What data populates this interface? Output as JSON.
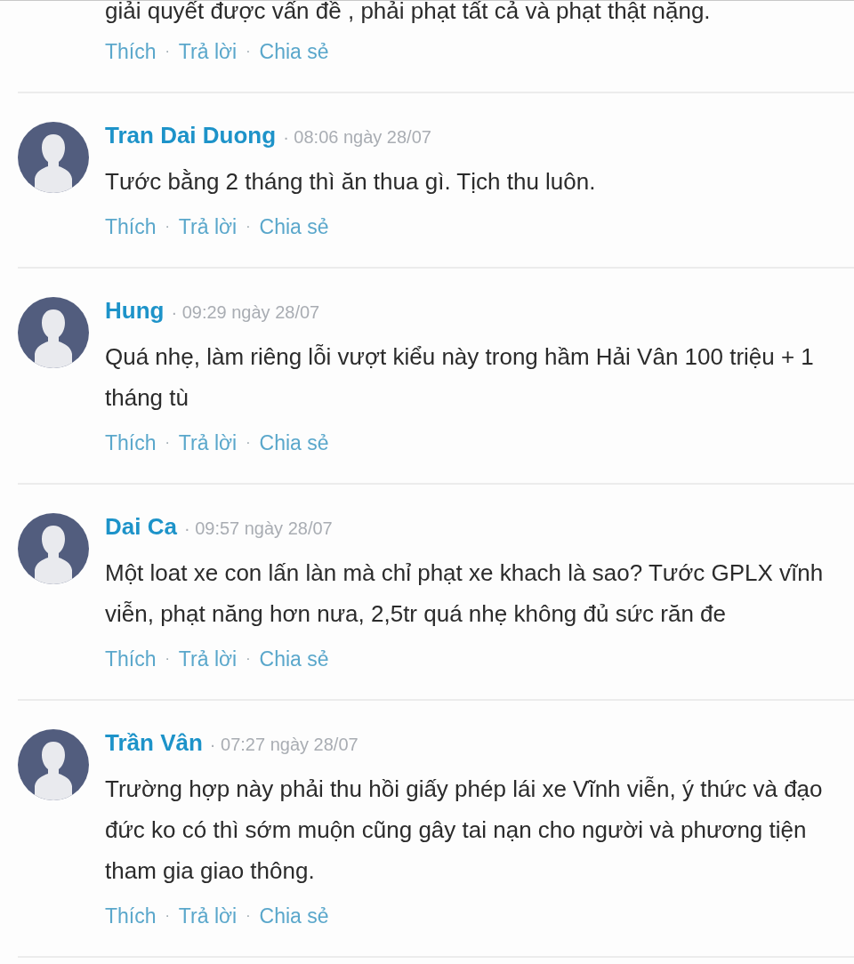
{
  "partial_comment": {
    "body": "giải quyết được vấn đề , phải phạt tất cả và phạt thật nặng.",
    "actions": [
      {
        "kind": "link",
        "label": "Thích"
      },
      {
        "kind": "separator",
        "label": "·"
      },
      {
        "kind": "link",
        "label": "Trả lời"
      },
      {
        "kind": "separator",
        "label": "·"
      },
      {
        "kind": "link",
        "label": "Chia sẻ"
      }
    ]
  },
  "comments": [
    {
      "name": "Tran Dai Duong",
      "meta": "· 08:06 ngày 28/07",
      "body": "Tước bằng 2 tháng thì ăn thua gì. Tịch thu luôn.",
      "actions": [
        {
          "kind": "link",
          "label": "Thích"
        },
        {
          "kind": "separator",
          "label": "·"
        },
        {
          "kind": "link",
          "label": "Trả lời"
        },
        {
          "kind": "separator",
          "label": "·"
        },
        {
          "kind": "link",
          "label": "Chia sẻ"
        }
      ]
    },
    {
      "name": "Hung",
      "meta": "· 09:29 ngày 28/07",
      "body": "Quá nhẹ, làm riêng lỗi vượt kiểu này trong hầm Hải Vân 100 triệu + 1 tháng tù",
      "actions": [
        {
          "kind": "link",
          "label": "Thích"
        },
        {
          "kind": "separator",
          "label": "·"
        },
        {
          "kind": "link",
          "label": "Trả lời"
        },
        {
          "kind": "separator",
          "label": "·"
        },
        {
          "kind": "link",
          "label": "Chia sẻ"
        }
      ]
    },
    {
      "name": "Dai Ca",
      "meta": "· 09:57 ngày 28/07",
      "body": "Một loat xe con lấn làn mà chỉ phạt xe khach là sao? Tước GPLX vĩnh viễn, phạt năng hơn nưa, 2,5tr quá nhẹ không đủ sức răn đe",
      "actions": [
        {
          "kind": "link",
          "label": "Thích"
        },
        {
          "kind": "separator",
          "label": "·"
        },
        {
          "kind": "link",
          "label": "Trả lời"
        },
        {
          "kind": "separator",
          "label": "·"
        },
        {
          "kind": "link",
          "label": "Chia sẻ"
        }
      ]
    },
    {
      "name": "Trần Vân",
      "meta": "· 07:27 ngày 28/07",
      "body": "Trường hợp này phải thu hồi giấy phép lái xe Vĩnh viễn, ý thức và đạo đức ko có thì sớm muộn cũng gây tai nạn cho người và phương tiện tham gia giao thông.",
      "actions": [
        {
          "kind": "link",
          "label": "Thích"
        },
        {
          "kind": "separator",
          "label": "·"
        },
        {
          "kind": "link",
          "label": "Trả lời"
        },
        {
          "kind": "separator",
          "label": "·"
        },
        {
          "kind": "link",
          "label": "Chia sẻ"
        }
      ]
    }
  ]
}
